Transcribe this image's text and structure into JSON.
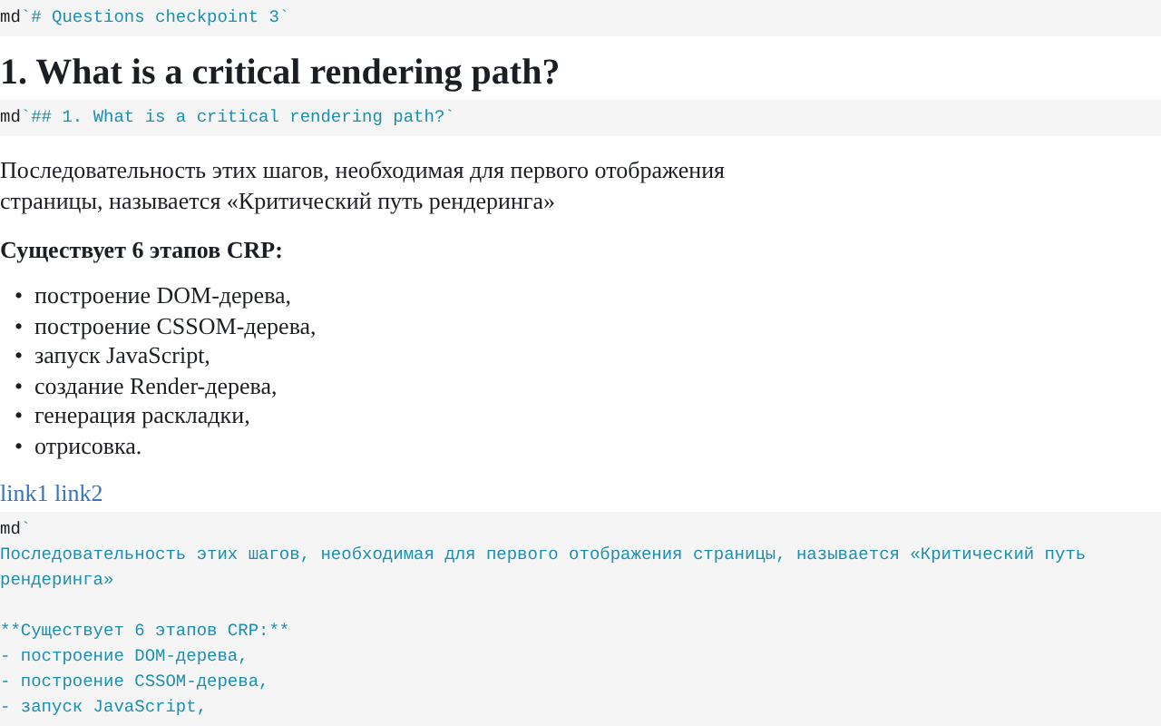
{
  "blocks": [
    {
      "kind": "code",
      "lines": [
        {
          "tag": "md",
          "text": "`# Questions checkpoint 3`"
        }
      ]
    },
    {
      "kind": "heading",
      "text": "1. What is a critical rendering path?"
    },
    {
      "kind": "code",
      "lines": [
        {
          "tag": "md",
          "text": "`## 1. What is a critical rendering path?`"
        }
      ]
    },
    {
      "kind": "markdown",
      "paragraph": "Последовательность этих шагов, необходимая для первого отображения страницы, называется «Критический путь рендеринга»",
      "bold_line": "Существует 6 этапов CRP:",
      "marker": "•",
      "items": [
        "построение DOM-дерева,",
        "построение CSSOM-дерева,",
        "запуск JavaScript,",
        "создание Render-дерева,",
        "генерация раскладки,",
        "отрисовка."
      ],
      "links": [
        "link1",
        "link2"
      ]
    },
    {
      "kind": "code",
      "lines": [
        {
          "tag": "md",
          "text": "`"
        },
        {
          "text": "Последовательность этих шагов, необходимая для первого отображения страницы, называется «Критический путь рендеринга»"
        },
        {
          "text": "\n**Существует 6 этапов CRP:**"
        },
        {
          "text": "- построение DOM-дерева,"
        },
        {
          "text": "- построение CSSOM-дерева,"
        },
        {
          "text": "- запуск JavaScript,"
        }
      ]
    }
  ]
}
